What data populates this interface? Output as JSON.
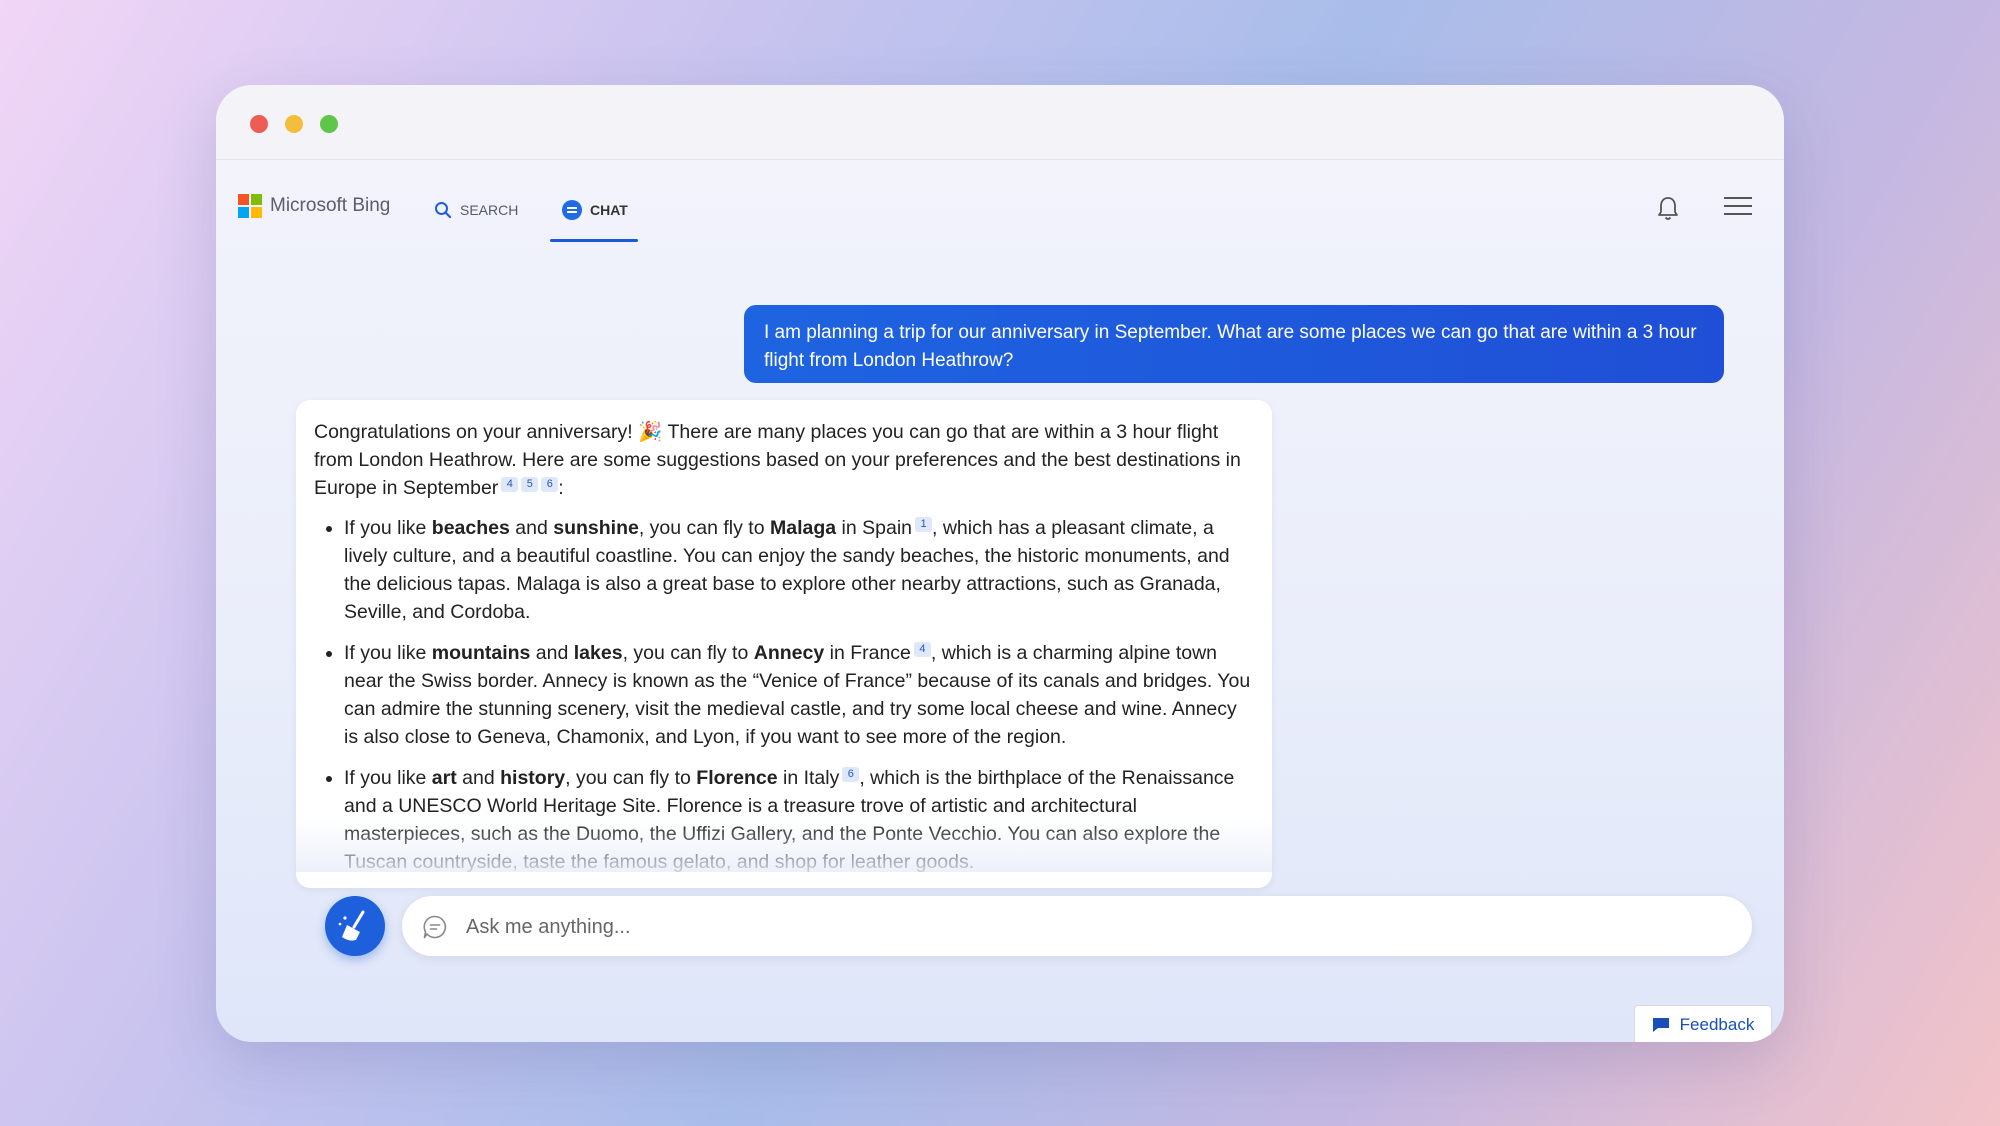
{
  "brand": {
    "name": "Microsoft Bing"
  },
  "nav": {
    "search_label": "SEARCH",
    "chat_label": "CHAT",
    "active_tab": "CHAT"
  },
  "user_message": "I am planning a trip for our anniversary in September. What are some places we can go that are within a 3 hour flight from London Heathrow?",
  "bot_message": {
    "intro_1": "Congratulations on your anniversary!",
    "intro_emoji": "🎉",
    "intro_2": "There are many places you can go that are within a 3 hour flight from London Heathrow. Here are some suggestions based on your preferences and the best destinations in Europe in September",
    "intro_cites": [
      "4",
      "5",
      "6"
    ],
    "intro_end": ":",
    "items": [
      {
        "pre": "If you like ",
        "interest1": "beaches",
        "and": " and ",
        "interest2": "sunshine",
        "mid": ", you can fly to ",
        "place": "Malaga",
        "country": " in Spain",
        "cite": "1",
        "text": ", which has a pleasant climate, a lively culture, and a beautiful coastline. You can enjoy the sandy beaches, the historic monuments, and the delicious tapas. Malaga is also a great base to explore other nearby attractions, such as Granada, Seville, and Cordoba."
      },
      {
        "pre": "If you like ",
        "interest1": "mountains",
        "and": " and ",
        "interest2": "lakes",
        "mid": ", you can fly to ",
        "place": "Annecy",
        "country": " in France",
        "cite": "4",
        "text": ", which is a charming alpine town near the Swiss border. Annecy is known as the “Venice of France” because of its canals and bridges. You can admire the stunning scenery, visit the medieval castle, and try some local cheese and wine. Annecy is also close to Geneva, Chamonix, and Lyon, if you want to see more of the region."
      },
      {
        "pre": "If you like ",
        "interest1": "art",
        "and": " and ",
        "interest2": "history",
        "mid": ", you can fly to ",
        "place": "Florence",
        "country": " in Italy",
        "cite": "6",
        "text": ", which is the birthplace of the Renaissance and a UNESCO World Heritage Site. Florence is a treasure trove of artistic and architectural masterpieces, such as the Duomo, the Uffizi Gallery, and the Ponte Vecchio. You can also explore the Tuscan countryside, taste the famous gelato, and shop for leather goods."
      }
    ]
  },
  "input": {
    "placeholder": "Ask me anything..."
  },
  "feedback_label": "Feedback",
  "colors": {
    "accent": "#1e5fdc",
    "user_bubble": "#1f5ddf",
    "traffic_red": "#ee5c53",
    "traffic_yellow": "#f4be3c",
    "traffic_green": "#5fc54b"
  },
  "icons": [
    "search-icon",
    "chat-icon",
    "bell-icon",
    "hamburger-menu-icon",
    "broom-icon",
    "chat-bubble-icon",
    "feedback-flag-icon"
  ]
}
